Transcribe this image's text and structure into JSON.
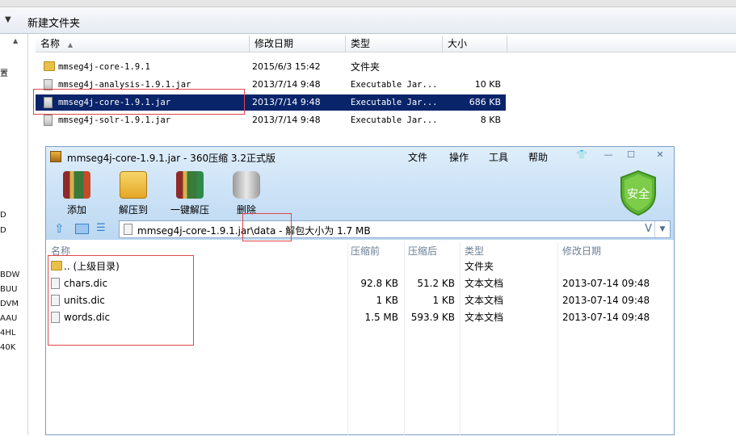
{
  "explorer": {
    "new_folder": "新建文件夹",
    "columns": {
      "name": "名称",
      "modified": "修改日期",
      "type": "类型",
      "size": "大小"
    },
    "files": [
      {
        "name": "mmseg4j-core-1.9.1",
        "modified": "2015/6/3 15:42",
        "type": "文件夹",
        "size": "",
        "icon": "folder-icon"
      },
      {
        "name": "mmseg4j-analysis-1.9.1.jar",
        "modified": "2013/7/14 9:48",
        "type": "Executable Jar...",
        "size": "10 KB",
        "icon": "jar-file-icon"
      },
      {
        "name": "mmseg4j-core-1.9.1.jar",
        "modified": "2013/7/14 9:48",
        "type": "Executable Jar...",
        "size": "686 KB",
        "icon": "jar-file-icon",
        "selected": true
      },
      {
        "name": "mmseg4j-solr-1.9.1.jar",
        "modified": "2013/7/14 9:48",
        "type": "Executable Jar...",
        "size": "8 KB",
        "icon": "jar-file-icon"
      }
    ],
    "nav_fragments": [
      "置",
      "D",
      "D",
      "BDW",
      "BUU",
      "DVM",
      "AAU",
      "4HL",
      "40K"
    ]
  },
  "archive": {
    "title": "mmseg4j-core-1.9.1.jar - 360压缩 3.2正式版",
    "menu": [
      "文件",
      "操作",
      "工具",
      "帮助"
    ],
    "tools": [
      {
        "label": "添加",
        "icon": "add-archive-icon"
      },
      {
        "label": "解压到",
        "icon": "extract-to-icon"
      },
      {
        "label": "一键解压",
        "icon": "one-click-extract-icon"
      },
      {
        "label": "删除",
        "icon": "delete-icon"
      }
    ],
    "security_badge": "安全",
    "address": "mmseg4j-core-1.9.1.jar\\data - 解包大小为 1.7 MB",
    "columns": {
      "name": "名称",
      "before": "压缩前",
      "after": "压缩后",
      "type": "类型",
      "modified": "修改日期"
    },
    "rows": [
      {
        "name": ".. (上级目录)",
        "before": "",
        "after": "",
        "type": "文件夹",
        "modified": "",
        "icon": "folder-icon"
      },
      {
        "name": "chars.dic",
        "before": "92.8 KB",
        "after": "51.2 KB",
        "type": "文本文档",
        "modified": "2013-07-14 09:48",
        "icon": "file-icon"
      },
      {
        "name": "units.dic",
        "before": "1 KB",
        "after": "1 KB",
        "type": "文本文档",
        "modified": "2013-07-14 09:48",
        "icon": "file-icon"
      },
      {
        "name": "words.dic",
        "before": "1.5 MB",
        "after": "593.9 KB",
        "type": "文本文档",
        "modified": "2013-07-14 09:48",
        "icon": "file-icon"
      }
    ]
  }
}
